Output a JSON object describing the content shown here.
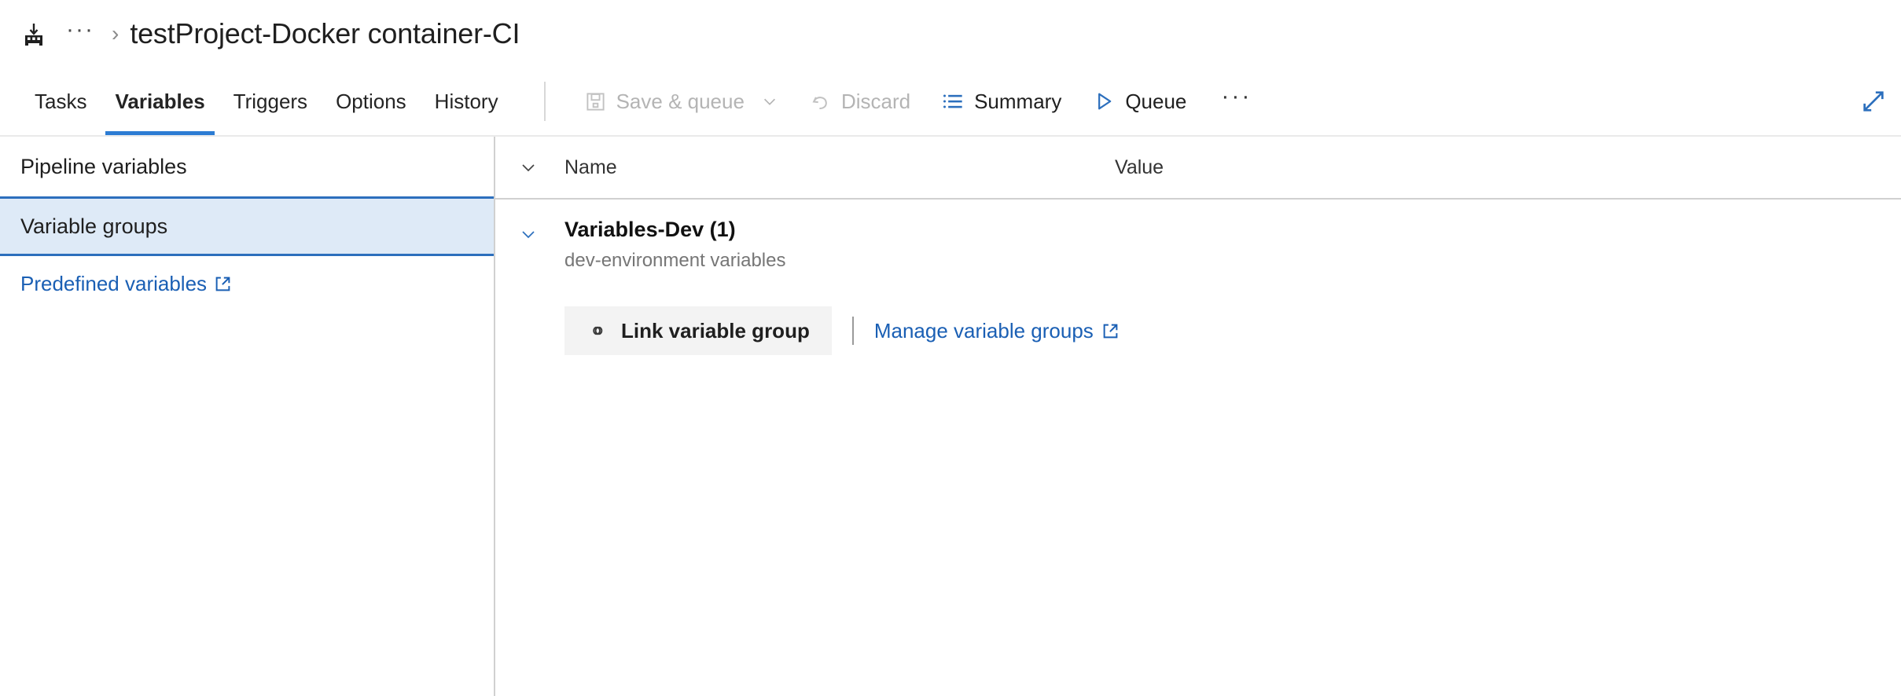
{
  "breadcrumb": {
    "project_icon": "build-pipeline-icon",
    "ellipsis": "···",
    "separator": "›",
    "title": "testProject-Docker container-CI"
  },
  "tabs": [
    {
      "label": "Tasks",
      "active": false
    },
    {
      "label": "Variables",
      "active": true
    },
    {
      "label": "Triggers",
      "active": false
    },
    {
      "label": "Options",
      "active": false
    },
    {
      "label": "History",
      "active": false
    }
  ],
  "toolbar": {
    "save_and_queue": "Save & queue",
    "discard": "Discard",
    "summary": "Summary",
    "queue": "Queue",
    "overflow": "···",
    "expand_icon": "expand-icon"
  },
  "sidebar": {
    "items": [
      {
        "label": "Pipeline variables",
        "selected": false
      },
      {
        "label": "Variable groups",
        "selected": true
      }
    ],
    "predefined_link": "Predefined variables"
  },
  "grid": {
    "columns": {
      "name": "Name",
      "value": "Value"
    },
    "groups": [
      {
        "title": "Variables-Dev (1)",
        "description": "dev-environment variables"
      }
    ]
  },
  "actions": {
    "link_variable_group": "Link variable group",
    "manage_variable_groups": "Manage variable groups"
  },
  "colors": {
    "accent_blue": "#2c7cd3",
    "link_blue": "#1a5fb4",
    "selected_bg": "#deeaf7",
    "selected_border": "#2c6fbd",
    "disabled_text": "#b4b4b4",
    "muted_text": "#767676"
  }
}
